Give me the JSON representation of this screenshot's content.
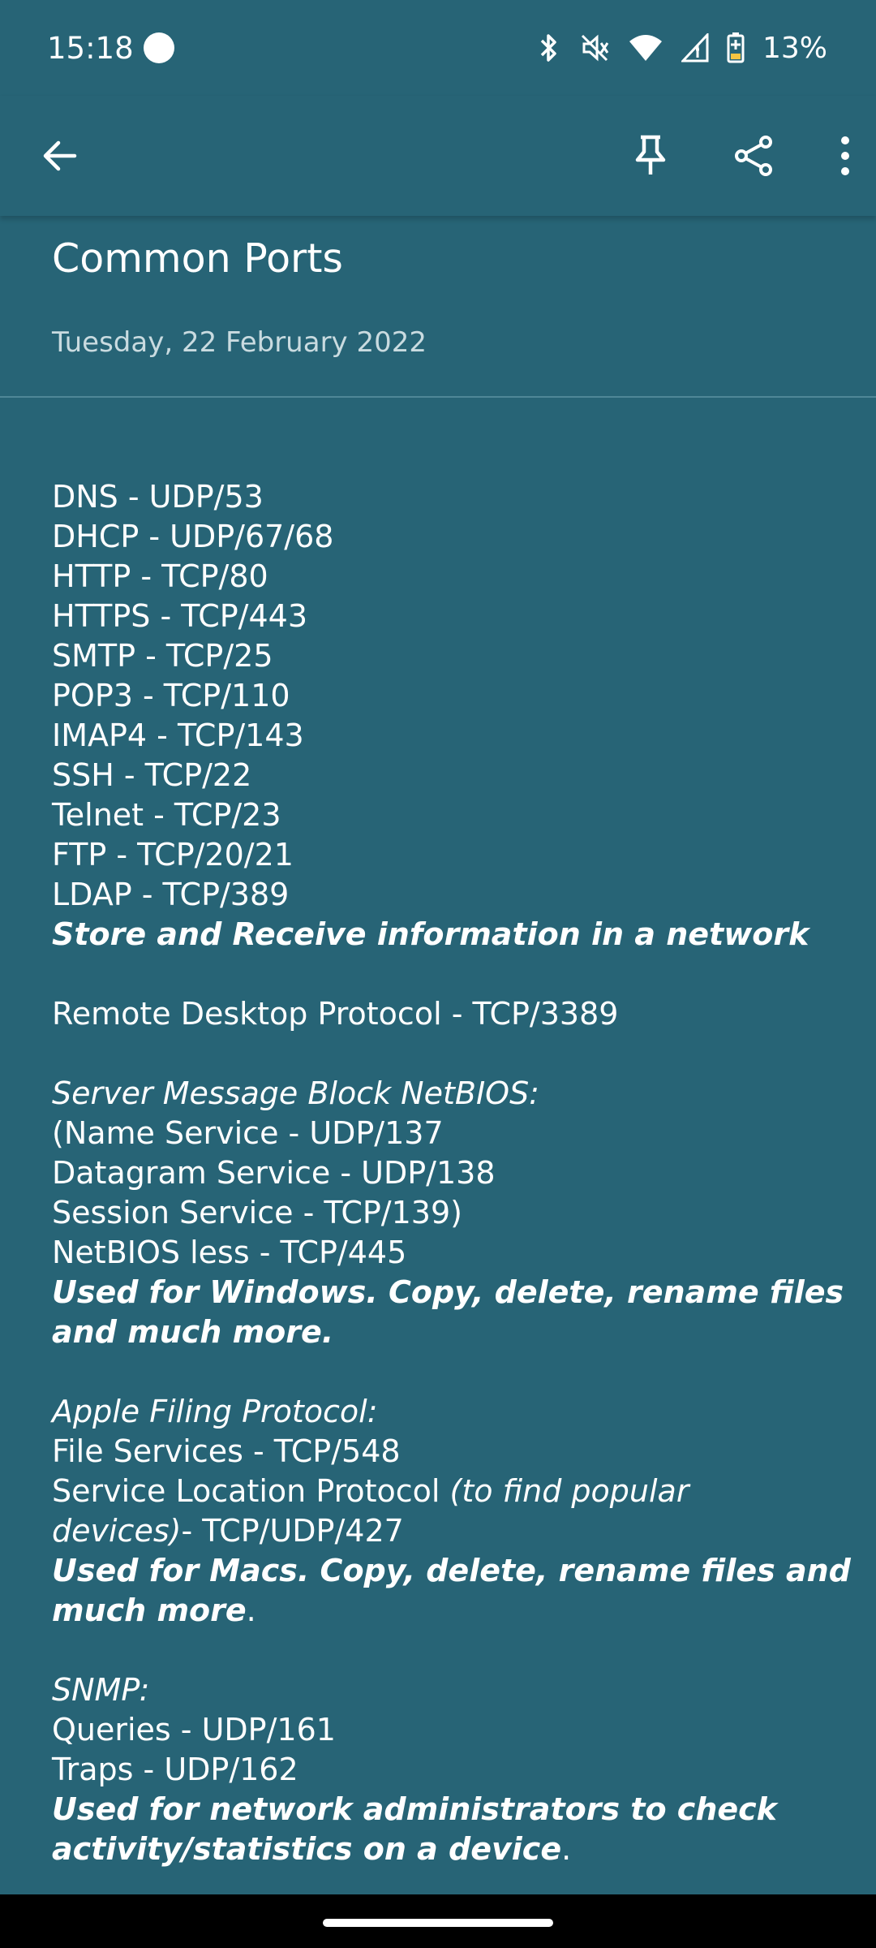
{
  "status_bar": {
    "time": "15:18",
    "battery": "13%",
    "icons": [
      "bluetooth-icon",
      "mute-icon",
      "wifi-icon",
      "signal-icon",
      "battery-charging-icon"
    ]
  },
  "app_bar": {
    "back_icon": "back-arrow-icon",
    "pin_icon": "pin-icon",
    "share_icon": "share-icon",
    "more_icon": "more-vert-icon"
  },
  "note": {
    "title": "Common Ports",
    "date": "Tuesday, 22 February 2022",
    "ports": [
      "DNS - UDP/53",
      "DHCP - UDP/67/68",
      "HTTP - TCP/80",
      "HTTPS - TCP/443",
      "SMTP - TCP/25",
      "POP3 - TCP/110",
      "IMAP4 - TCP/143",
      "SSH - TCP/22",
      "Telnet - TCP/23",
      "FTP - TCP/20/21",
      "LDAP - TCP/389"
    ],
    "ports_note": "Store and Receive information in a network",
    "rdp": "Remote Desktop Protocol - TCP/3389",
    "smb": {
      "heading": "Server Message Block NetBIOS:",
      "lines": [
        "(Name Service - UDP/137",
        "Datagram Service - UDP/138",
        "Session Service - TCP/139)",
        "NetBIOS less - TCP/445"
      ],
      "note_1": "Used for Windows. Copy, delete, rename files",
      "note_2": "and much more."
    },
    "afp": {
      "heading": "Apple Filing Protocol:",
      "line_1": "File Services - TCP/548",
      "line_2_plain": "Service Location Protocol ",
      "line_2_italic": "(to find popular",
      "line_3_italic": "devices)",
      "line_3_plain": "- TCP/UDP/427",
      "note_1": "Used for Macs. Copy, delete, rename files and",
      "note_2": "much more",
      "note_2_end": "."
    },
    "snmp": {
      "heading": "SNMP:",
      "lines": [
        "Queries - UDP/161",
        "Traps - UDP/162"
      ],
      "note_1": "Used for network administrators to check",
      "note_2": "activity/statistics on a device",
      "note_2_end": "."
    }
  }
}
